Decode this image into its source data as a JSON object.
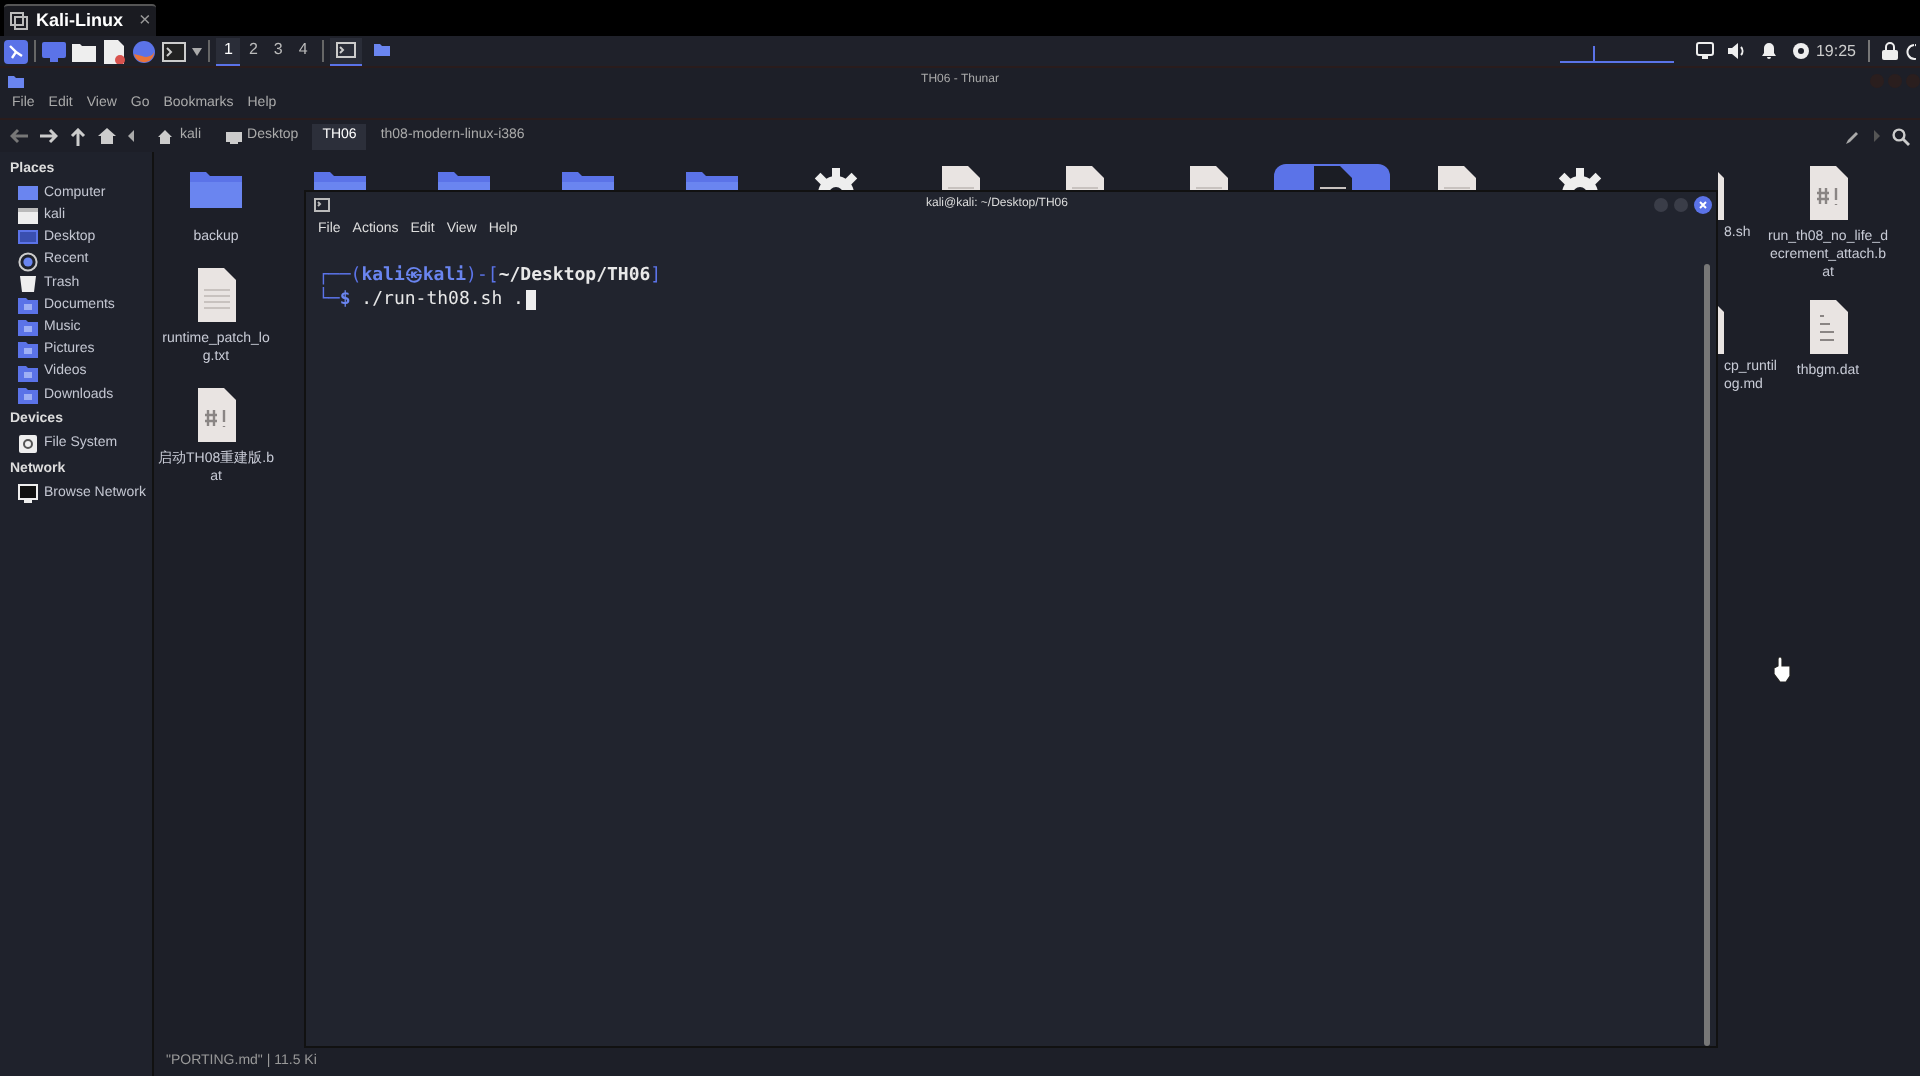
{
  "top_tab": {
    "label": "Kali-Linux",
    "close": "×"
  },
  "panel": {
    "launchers": [
      {
        "kind": "desktop"
      },
      {
        "kind": "folder"
      },
      {
        "kind": "editor"
      },
      {
        "kind": "browser"
      },
      {
        "kind": "terminal"
      }
    ],
    "workspaces": [
      {
        "label": "1",
        "selected": true
      },
      {
        "label": "2",
        "selected": false
      },
      {
        "label": "3",
        "selected": false
      },
      {
        "label": "4",
        "selected": false
      }
    ],
    "tasks": [
      {
        "kind": "terminal",
        "selected": true
      },
      {
        "kind": "folder",
        "selected": false
      }
    ],
    "tray": [
      {
        "kind": "display"
      },
      {
        "kind": "volume"
      },
      {
        "kind": "bell"
      },
      {
        "kind": "power"
      }
    ],
    "clock": "19:25"
  },
  "thunar": {
    "title": "TH06 - Thunar",
    "menu": [
      "File",
      "Edit",
      "View",
      "Go",
      "Bookmarks",
      "Help"
    ],
    "path": [
      {
        "label": "kali",
        "kind": "home",
        "selected": false
      },
      {
        "label": "Desktop",
        "kind": "desktop",
        "selected": false
      },
      {
        "label": "TH06",
        "kind": "plain",
        "selected": true
      },
      {
        "label": "th08-modern-linux-i386",
        "kind": "plain",
        "selected": false
      }
    ],
    "sidebar": [
      {
        "heading": "Places",
        "items": [
          {
            "label": "Computer",
            "kind": "computer"
          },
          {
            "label": "kali",
            "kind": "home"
          },
          {
            "label": "Desktop",
            "kind": "desktop"
          },
          {
            "label": "Recent",
            "kind": "recent"
          },
          {
            "label": "Trash",
            "kind": "trash"
          },
          {
            "label": "Documents",
            "kind": "folder"
          },
          {
            "label": "Music",
            "kind": "folder"
          },
          {
            "label": "Pictures",
            "kind": "folder"
          },
          {
            "label": "Videos",
            "kind": "folder"
          },
          {
            "label": "Downloads",
            "kind": "folder"
          }
        ]
      },
      {
        "heading": "Devices",
        "items": [
          {
            "label": "File System",
            "kind": "drive"
          }
        ]
      },
      {
        "heading": "Network",
        "items": [
          {
            "label": "Browse Network",
            "kind": "network"
          }
        ]
      }
    ],
    "left_files": [
      {
        "name": "backup",
        "kind": "folder"
      },
      {
        "name": "runtime_patch_log.txt",
        "kind": "doc"
      },
      {
        "name": "启动TH08重建版.bat",
        "kind": "script"
      }
    ],
    "top_row_icons": [
      {
        "kind": "folder",
        "selected": false
      },
      {
        "kind": "folder",
        "selected": false
      },
      {
        "kind": "folder",
        "selected": false
      },
      {
        "kind": "folder",
        "selected": false
      },
      {
        "kind": "gear",
        "selected": false
      },
      {
        "kind": "doc",
        "selected": false
      },
      {
        "kind": "doc",
        "selected": false
      },
      {
        "kind": "doc",
        "selected": false
      },
      {
        "kind": "doc",
        "selected": true
      },
      {
        "kind": "doc",
        "selected": false
      },
      {
        "kind": "gear",
        "selected": false
      }
    ],
    "right_files": [
      {
        "name": "8.sh",
        "kind": "script",
        "partial": true
      },
      {
        "name": "run_th08_no_life_decrement_attach.bat",
        "kind": "script",
        "partial": false
      },
      {
        "name": "cp_runtilog.md",
        "kind": "doc",
        "partial": true
      },
      {
        "name": "thbgm.dat",
        "kind": "data",
        "partial": false
      }
    ],
    "status_bar": "\"PORTING.md\" | 11.5 Ki"
  },
  "terminal": {
    "title": "kali@kali: ~/Desktop/TH06",
    "menu": [
      "File",
      "Actions",
      "Edit",
      "View",
      "Help"
    ],
    "lines": [
      [
        {
          "text": "┌──(",
          "kind": "frame"
        },
        {
          "text": "kali㉿kali",
          "kind": "user"
        },
        {
          "text": ")-[",
          "kind": "frame"
        },
        {
          "text": "~/Desktop/TH06",
          "kind": "path"
        },
        {
          "text": "]",
          "kind": "frame"
        }
      ],
      [
        {
          "text": "└─",
          "kind": "frame"
        },
        {
          "text": "$",
          "kind": "user"
        },
        {
          "text": " ./run-th08.sh .",
          "kind": "command"
        }
      ]
    ]
  }
}
